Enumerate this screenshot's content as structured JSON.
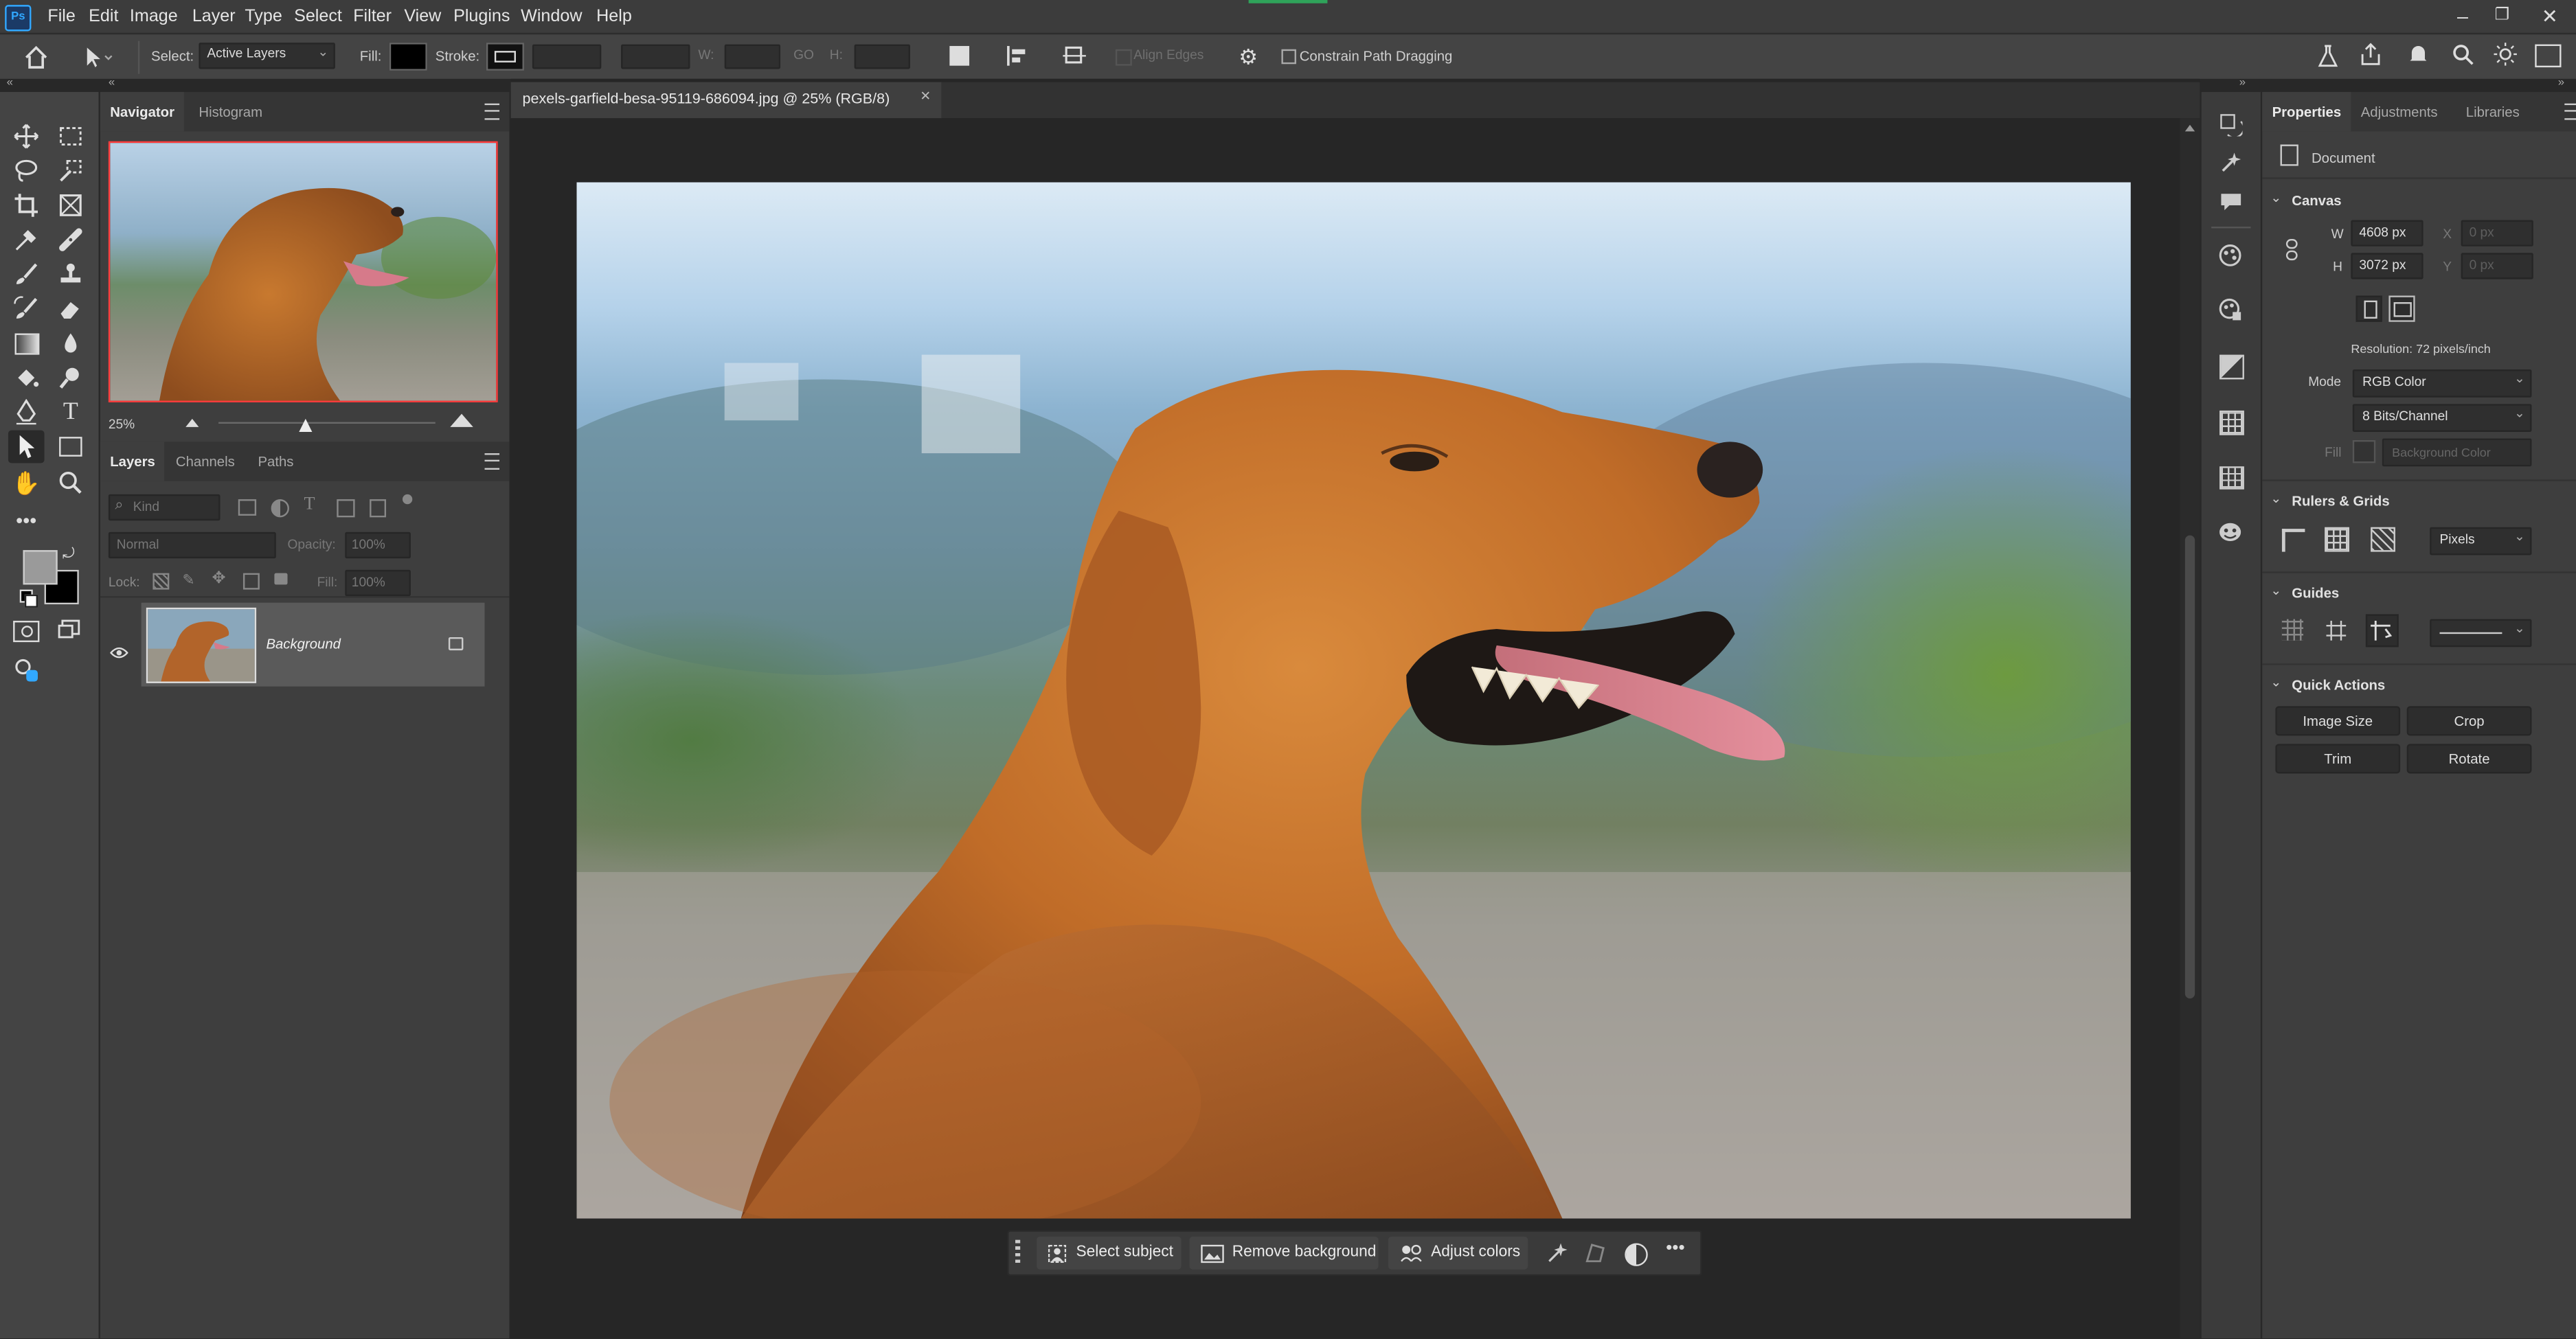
{
  "app": {
    "logo": "Ps"
  },
  "menu": [
    "File",
    "Edit",
    "Image",
    "Layer",
    "Type",
    "Select",
    "Filter",
    "View",
    "Plugins",
    "Window",
    "Help"
  ],
  "options": {
    "select_label": "Select:",
    "select_value": "Active Layers",
    "fill_label": "Fill:",
    "stroke_label": "Stroke:",
    "w_label": "W:",
    "h_label": "H:",
    "align_edges": "Align Edges",
    "constrain": "Constrain Path Dragging"
  },
  "navigator": {
    "tabs": [
      "Navigator",
      "Histogram"
    ],
    "zoom": "25%"
  },
  "layers_panel": {
    "tabs": [
      "Layers",
      "Channels",
      "Paths"
    ],
    "kind_placeholder": "Kind",
    "blend_mode": "Normal",
    "opacity_label": "Opacity:",
    "opacity_value": "100%",
    "lock_label": "Lock:",
    "fill_label": "Fill:",
    "fill_value": "100%",
    "layers": [
      {
        "name": "Background"
      }
    ]
  },
  "document": {
    "tab_title": "pexels-garfield-besa-95119-686094.jpg @ 25% (RGB/8)"
  },
  "context_bar": {
    "select_subject": "Select subject",
    "remove_background": "Remove background",
    "adjust_colors": "Adjust colors"
  },
  "properties": {
    "tabs": [
      "Properties",
      "Adjustments",
      "Libraries"
    ],
    "document_label": "Document",
    "canvas_heading": "Canvas",
    "w_label": "W",
    "w_value": "4608 px",
    "h_label": "H",
    "h_value": "3072 px",
    "x_label": "X",
    "x_value": "0 px",
    "y_label": "Y",
    "y_value": "0 px",
    "resolution": "Resolution: 72 pixels/inch",
    "mode_label": "Mode",
    "mode_value": "RGB Color",
    "bits_value": "8 Bits/Channel",
    "fill_label": "Fill",
    "fill_value": "Background Color",
    "rulers_heading": "Rulers & Grids",
    "units_value": "Pixels",
    "guides_heading": "Guides",
    "quick_actions_heading": "Quick Actions",
    "quick_actions": [
      "Image Size",
      "Crop",
      "Trim",
      "Rotate"
    ]
  },
  "colors": {
    "accent": "#ff3c3c",
    "foreground": "#9a9a9a",
    "background": "#000000"
  }
}
